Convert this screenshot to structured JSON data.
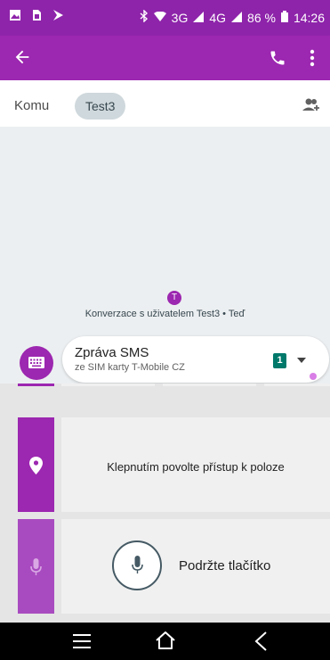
{
  "status_bar": {
    "network_text": "3G",
    "network_text_2": "4G",
    "battery": "86 %",
    "time": "14:26"
  },
  "app_bar": {
    "back_icon": "arrow-left-icon",
    "call_icon": "phone-icon",
    "menu_icon": "more-vert-icon"
  },
  "recipients": {
    "label": "Komu",
    "chip": "Test3",
    "add_icon": "add-person-icon"
  },
  "conversation": {
    "avatar_letter": "T",
    "info": "Konverzace s uživatelem Test3 • Teď"
  },
  "compose": {
    "title": "Zpráva SMS",
    "subtitle": "ze SIM karty T-Mobile CZ",
    "sim_number": "1"
  },
  "attachments": {
    "location_text": "Klepnutím povolte přístup k poloze",
    "hold_text": "Podržte tlačítko"
  },
  "colors": {
    "primary": "#9c27b0",
    "status": "#8e24aa",
    "sim": "#00796b"
  }
}
